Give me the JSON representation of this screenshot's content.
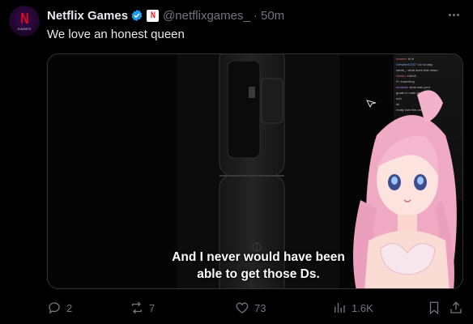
{
  "author": {
    "display_name": "Netflix Games",
    "handle": "@netflixgames_",
    "time": "· 50m",
    "avatar_letter": "N",
    "avatar_caption": "GAMES",
    "affiliate_letter": "N"
  },
  "tweet": {
    "text": "We love an honest queen"
  },
  "media": {
    "subtitle_line1": "And I never would have been",
    "subtitle_line2": "able to get those Ds.",
    "chat_lines": [
      {
        "user": "Arvenn:",
        "msg": "hi hi"
      },
      {
        "user": "Drewbert1337:",
        "msg": "lol no way"
      },
      {
        "user": "",
        "msg": "sarah_: what does that mean"
      },
      {
        "user": "Nimbu:",
        "msg": "HAHA"
      },
      {
        "user": "",
        "msg": "Fl: expecting"
      },
      {
        "user": "kodama:",
        "msg": "what was your"
      },
      {
        "user": "",
        "msg": "grade in math lol"
      },
      {
        "user": "",
        "msg": "ooh"
      },
      {
        "user": "",
        "msg": "lol"
      },
      {
        "user": "",
        "msg": "really love this one"
      }
    ]
  },
  "actions": {
    "replies": "2",
    "reposts": "7",
    "likes": "73",
    "views": "1.6K"
  },
  "colors": {
    "background": "#000000",
    "text": "#e7e9ea",
    "muted": "#71767b",
    "verified": "#1d9bf0",
    "netflix_red": "#e50914"
  },
  "icons": {
    "verified": "verified-badge-icon",
    "more": "more-icon",
    "reply": "reply-icon",
    "repost": "repost-icon",
    "like": "heart-icon",
    "views": "views-icon",
    "bookmark": "bookmark-icon",
    "share": "share-icon"
  }
}
